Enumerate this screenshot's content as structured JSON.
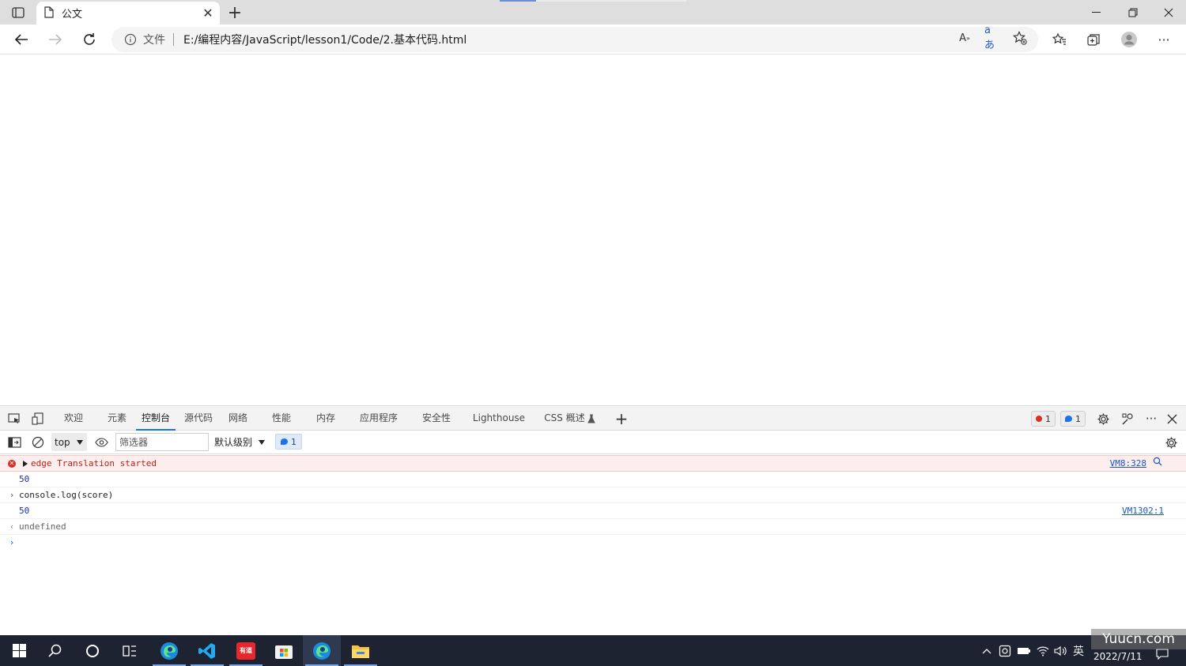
{
  "browser": {
    "tab": {
      "title": "公文"
    },
    "address": {
      "scheme_label": "文件",
      "url": "E:/编程内容/JavaScript/lesson1/Code/2.基本代码.html"
    },
    "translate_label": "aあ"
  },
  "devtools": {
    "tabs": [
      {
        "label": "欢迎"
      },
      {
        "label": "元素"
      },
      {
        "label": "控制台",
        "active": true
      },
      {
        "label": "源代码"
      },
      {
        "label": "网络"
      },
      {
        "label": "性能"
      },
      {
        "label": "内存"
      },
      {
        "label": "应用程序"
      },
      {
        "label": "安全性"
      },
      {
        "label": "Lighthouse"
      },
      {
        "label": "CSS 概述"
      }
    ],
    "error_count": "1",
    "message_count": "1",
    "context": "top",
    "filter_placeholder": "筛选器",
    "level": "默认级别",
    "issues_count": "1",
    "console_lines": [
      {
        "kind": "error",
        "text": "edge Translation started",
        "source": "VM8:328"
      },
      {
        "kind": "log",
        "text": "50",
        "source": ""
      },
      {
        "kind": "input",
        "text": "console.log(score)",
        "source": ""
      },
      {
        "kind": "log",
        "text": "50",
        "source": "VM1302:1"
      },
      {
        "kind": "result",
        "text": "undefined",
        "source": ""
      }
    ]
  },
  "taskbar": {
    "date": "2022/7/11",
    "ime": "英",
    "youdao_label": "有道"
  },
  "watermark": "Yuucn.com",
  "colors": {
    "accent": "#1a73e8",
    "error": "#d93025",
    "taskbar": "#1d2330"
  }
}
